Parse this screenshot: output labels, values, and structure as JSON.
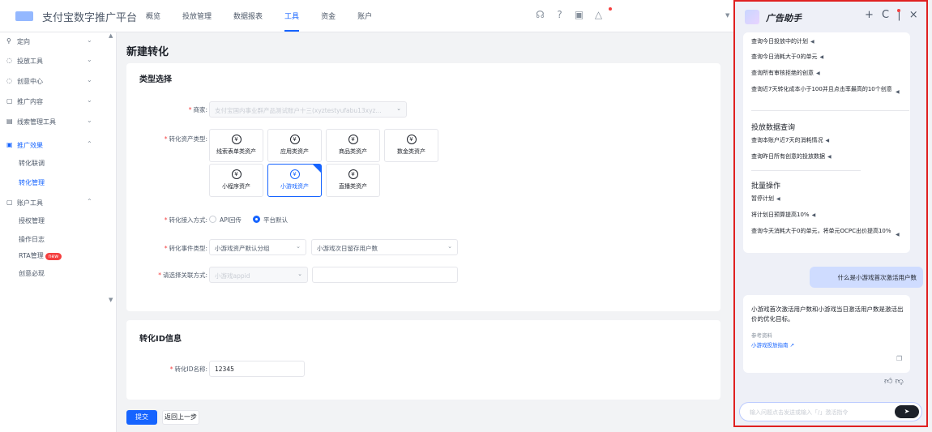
{
  "app": {
    "brand": "支付宝数字推广平台"
  },
  "topnav": {
    "items": [
      "概览",
      "投放管理",
      "数据报表",
      "工具",
      "资金",
      "账户"
    ],
    "active_index": 3
  },
  "top_icons": [
    "headset-icon",
    "help-icon",
    "calendar-icon",
    "bell-icon"
  ],
  "sidebar": {
    "items": [
      {
        "icon": "定向",
        "label": "定向",
        "glyph": "⚲"
      },
      {
        "icon": "投放工具",
        "label": "投放工具",
        "glyph": "◌"
      },
      {
        "icon": "创意中心",
        "label": "创意中心",
        "glyph": "◌"
      },
      {
        "icon": "推广内容",
        "label": "推广内容",
        "glyph": "▢"
      },
      {
        "icon": "线索管理工具",
        "label": "线索管理工具",
        "glyph": "▤"
      },
      {
        "icon": "推广效果",
        "label": "推广效果",
        "glyph": "▣"
      },
      {
        "icon": "账户工具",
        "label": "账户工具",
        "glyph": "▢"
      }
    ],
    "sub_effect": [
      "转化联调",
      "转化管理"
    ],
    "sub_account": [
      "授权管理",
      "操作日志",
      "RTA管理",
      "创意必现"
    ],
    "new_badge": "new"
  },
  "main": {
    "page_title": "新建转化",
    "type_section": {
      "title": "类型选择",
      "merchant_label": "商家:",
      "merchant_value": "支付宝国内事业群产品测试账户十三(xyztestyufabu13xyz...",
      "asset_type_label": "转化资产类型:",
      "asset_tiles": [
        "线索表单类资产",
        "应用类资产",
        "商品类资产",
        "数金类资产",
        "小程序资产",
        "小游戏资产",
        "直播类资产"
      ],
      "selected_tile": "小游戏资产",
      "yen_glyph": "¥",
      "access_label": "转化接入方式:",
      "access_options": [
        "API回传",
        "平台默认"
      ],
      "access_selected": "平台默认",
      "event_label": "转化事件类型:",
      "event_group": "小游戏资产默认分组",
      "event_value": "小游戏次日留存用户数",
      "assoc_label": "请选择关联方式:",
      "assoc_value": "小游戏appid",
      "assoc_input": ""
    },
    "id_section": {
      "title": "转化ID信息",
      "name_label": "转化ID名称:",
      "name_value": "12345"
    },
    "submit_label": "提交",
    "back_label": "返回上一步"
  },
  "assistant": {
    "title": "广告助手",
    "header_icons": [
      "+",
      "C",
      "|",
      "×"
    ],
    "suggestions_top": [
      "查询今日投放中的计划",
      "查询今日消耗大于0的单元",
      "查询所有审核拒绝的创意",
      "查询近7天转化成本小于100并且点击率最高的10个创意"
    ],
    "section_query": "投放数据查询",
    "suggestions_query": [
      "查询本账户近7天的消耗情况",
      "查询昨日所有创意的投放数据"
    ],
    "section_batch": "批量操作",
    "suggestions_batch": [
      "暂停计划",
      "将计划日预算提高10%",
      "查询今天消耗大于0的单元，将单元OCPC出价提高10%"
    ],
    "pin_glyph": "◀",
    "user_message": "什么是小游戏首次激活用户数",
    "answer": "小游戏首次激活用户数和小游戏当日激活用户数是激活出价的优化目标。",
    "ref_label": "参考资料",
    "ref_link": "小游戏投放指南",
    "input_placeholder": "输入问题点击发送或输入「/」激活指令",
    "send_glyph": "➤"
  }
}
